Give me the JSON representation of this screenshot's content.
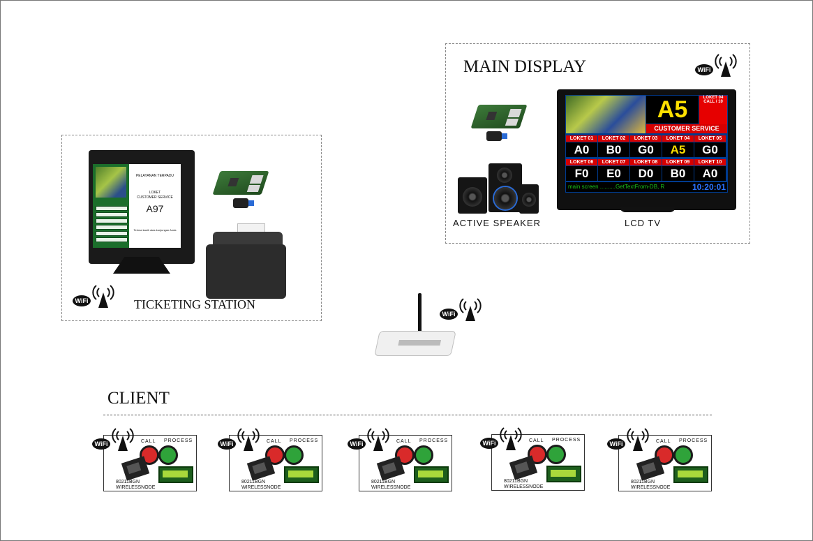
{
  "main_display": {
    "title": "MAIN DISPLAY",
    "active_speaker_label": "ACTIVE SPEAKER",
    "lcd_tv_label": "LCD TV",
    "tv": {
      "current_ticket": "A5",
      "side_box_line1": "LOKET 04",
      "side_box_line2": "CALL / 10",
      "service_name": "CUSTOMER SERVICE",
      "row1_headers": [
        "LOKET 01",
        "LOKET 02",
        "LOKET 03",
        "LOKET 04",
        "LOKET 05"
      ],
      "row1_values": [
        "A0",
        "B0",
        "G0",
        "A5",
        "G0"
      ],
      "row2_headers": [
        "LOKET 06",
        "LOKET 07",
        "LOKET 08",
        "LOKET 09",
        "LOKET 10"
      ],
      "row2_values": [
        "F0",
        "E0",
        "D0",
        "B0",
        "A0"
      ],
      "footer_text": "main screen ..........GetTextFrom-DB, R",
      "clock": "10:20:01",
      "highlight_color": "#ffe000"
    }
  },
  "ticketing_station": {
    "title": "TICKETING STATION",
    "kiosk": {
      "header_line": "PELAYANAN TERPADU",
      "loket_label": "LOKET",
      "service": "CUSTOMER SERVICE",
      "ticket_number": "A97",
      "footer_note": "Terima kasih atas kunjungan Anda"
    }
  },
  "client": {
    "title": "CLIENT",
    "nodes": [
      {
        "call_label": "CALL",
        "process_label": "PROCESS",
        "line1": "80211BGN",
        "line2": "WIRELESSNODE"
      },
      {
        "call_label": "CALL",
        "process_label": "PROCESS",
        "line1": "80211BGN",
        "line2": "WIRELESSNODE"
      },
      {
        "call_label": "CALL",
        "process_label": "PROCESS",
        "line1": "80211BGN",
        "line2": "WIRELESSNODE"
      },
      {
        "call_label": "CALL",
        "process_label": "PROCESS",
        "line1": "80211BGN",
        "line2": "WIRELESSNODE"
      },
      {
        "call_label": "CALL",
        "process_label": "PROCESS",
        "line1": "80211BGN",
        "line2": "WIRELESSNODE"
      }
    ]
  },
  "icons": {
    "wifi": "wifi-icon",
    "router": "wireless-router-icon",
    "printer": "thermal-printer-icon",
    "raspberry_pi": "raspberry-pi-icon",
    "usb_wifi": "usb-wifi-dongle-icon"
  },
  "colors": {
    "button_call": "#d92a2a",
    "button_process": "#2fa33a",
    "tv_blue": "#003b8e",
    "tv_red": "#d60000"
  }
}
